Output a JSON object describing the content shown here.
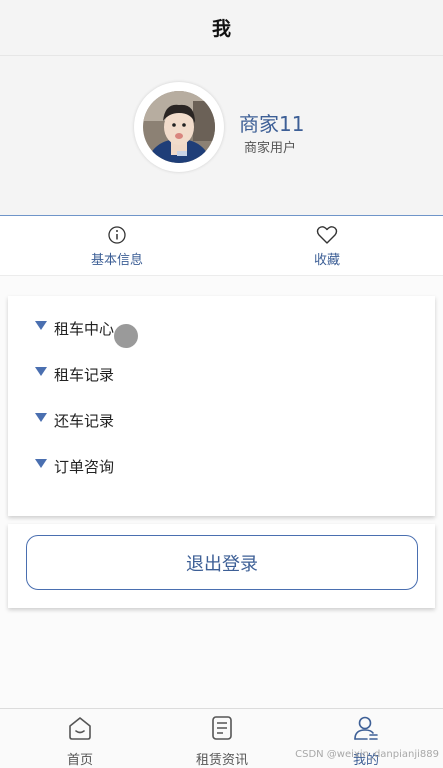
{
  "header": {
    "title": "我"
  },
  "profile": {
    "name": "商家11",
    "role": "商家用户"
  },
  "tabs": [
    {
      "label": "基本信息",
      "icon": "info-icon"
    },
    {
      "label": "收藏",
      "icon": "heart-icon"
    }
  ],
  "menu": {
    "items": [
      {
        "label": "租车中心"
      },
      {
        "label": "租车记录"
      },
      {
        "label": "还车记录"
      },
      {
        "label": "订单咨询"
      }
    ]
  },
  "logout": {
    "label": "退出登录"
  },
  "tabbar": {
    "items": [
      {
        "label": "首页",
        "icon": "home-icon"
      },
      {
        "label": "租赁资讯",
        "icon": "document-icon"
      },
      {
        "label": "我的",
        "icon": "user-icon"
      }
    ]
  },
  "watermark": "CSDN @weixin_danpianji889",
  "colors": {
    "accent": "#3d5f96",
    "marker": "#4a6fb0",
    "inactive": "#555555"
  }
}
